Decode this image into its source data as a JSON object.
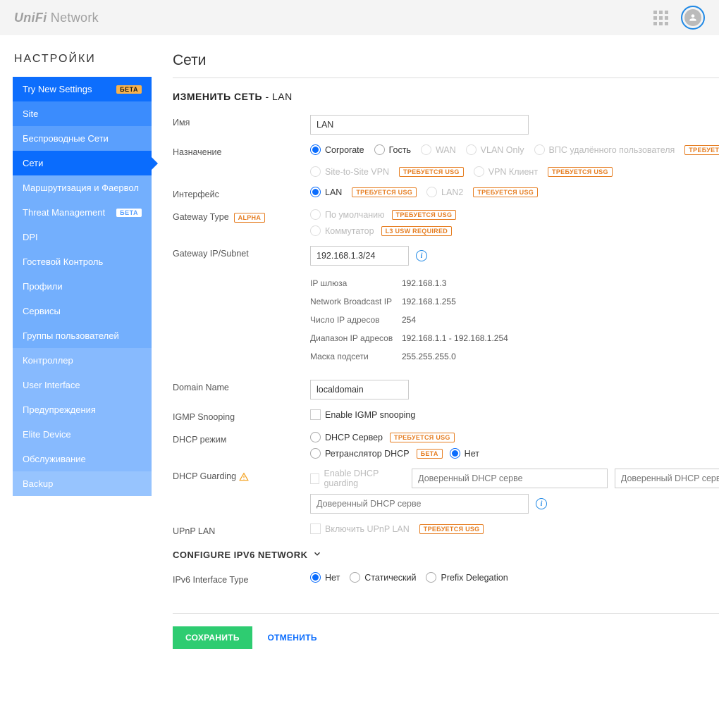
{
  "top": {
    "brand_a": "UniFi",
    "brand_b": " Network"
  },
  "sidebar": {
    "title": "НАСТРОЙКИ",
    "items": [
      {
        "label": "Try New Settings",
        "badge": "БЕТА",
        "badge_cls": "beta-o",
        "cls": "shade0"
      },
      {
        "label": "Site",
        "cls": "shade1"
      },
      {
        "label": "Беспроводные Сети",
        "cls": "shade2"
      },
      {
        "label": "Сети",
        "cls": "active"
      },
      {
        "label": "Маршрутизация и Фаервол",
        "cls": "shade3"
      },
      {
        "label": "Threat Management",
        "badge": "БЕТА",
        "badge_cls": "beta-w",
        "cls": "shade3"
      },
      {
        "label": "DPI",
        "cls": "shade3"
      },
      {
        "label": "Гостевой Контроль",
        "cls": "shade3"
      },
      {
        "label": "Профили",
        "cls": "shade3"
      },
      {
        "label": "Сервисы",
        "cls": "shade3"
      },
      {
        "label": "Группы пользователей",
        "cls": "shade3"
      },
      {
        "label": "Контроллер",
        "cls": "sec"
      },
      {
        "label": "User Interface",
        "cls": "sec"
      },
      {
        "label": "Предупреждения",
        "cls": "sec"
      },
      {
        "label": "Elite Device",
        "cls": "sec"
      },
      {
        "label": "Обслуживание",
        "cls": "sec"
      },
      {
        "label": "Backup",
        "cls": "sec2"
      }
    ]
  },
  "page": {
    "title": "Сети",
    "edit_prefix": "ИЗМЕНИТЬ СЕТЬ",
    "edit_suffix": " - LAN"
  },
  "labels": {
    "name": "Имя",
    "purpose": "Назначение",
    "interface": "Интерфейс",
    "gw_type": "Gateway Type",
    "gw_ip": "Gateway IP/Subnet",
    "domain": "Domain Name",
    "igmp": "IGMP Snooping",
    "dhcp_mode": "DHCP режим",
    "dhcp_guard": "DHCP Guarding",
    "upnp": "UPnP LAN",
    "ipv6_sec": "CONFIGURE IPV6 NETWORK",
    "ipv6_type": "IPv6 Interface Type"
  },
  "values": {
    "name": "LAN",
    "gw_ip": "192.168.1.3/24",
    "domain": "localdomain"
  },
  "purpose_opts": {
    "corp": "Corporate",
    "guest": "Гость",
    "wan": "WAN",
    "vlan": "VLAN Only",
    "remote_vpn": "ВПС удалённого пользователя",
    "s2s": "Site-to-Site VPN",
    "vpn_client": "VPN Клиент"
  },
  "intf_opts": {
    "lan": "LAN",
    "lan2": "LAN2"
  },
  "gw_opts": {
    "def": "По умолчанию",
    "sw": "Коммутатор"
  },
  "ipinfo": {
    "gw_label": "IP шлюза",
    "gw": "192.168.1.3",
    "bcast_label": "Network Broadcast IP",
    "bcast": "192.168.1.255",
    "count_label": "Число IP адресов",
    "count": "254",
    "range_label": "Диапазон IP адресов",
    "range": "192.168.1.1 - 192.168.1.254",
    "mask_label": "Маска подсети",
    "mask": "255.255.255.0"
  },
  "igmp_chk": "Enable IGMP snooping",
  "dhcp_opts": {
    "server": "DHCP Сервер",
    "relay": "Ретранслятор DHCP",
    "none": "Нет"
  },
  "dhcp_guard": {
    "chk": "Enable DHCP guarding",
    "ph": "Доверенный DHCP серве"
  },
  "upnp_chk": "Включить UPnP LAN",
  "ipv6_opts": {
    "none": "Нет",
    "static": "Статический",
    "prefix": "Prefix Delegation"
  },
  "tags": {
    "usg": "ТРЕБУЕТСЯ USG",
    "alpha": "ALPHA",
    "l3": "L3 USW REQUIRED",
    "beta": "БЕТА"
  },
  "buttons": {
    "save": "СОХРАНИТЬ",
    "cancel": "ОТМЕНИТЬ"
  }
}
